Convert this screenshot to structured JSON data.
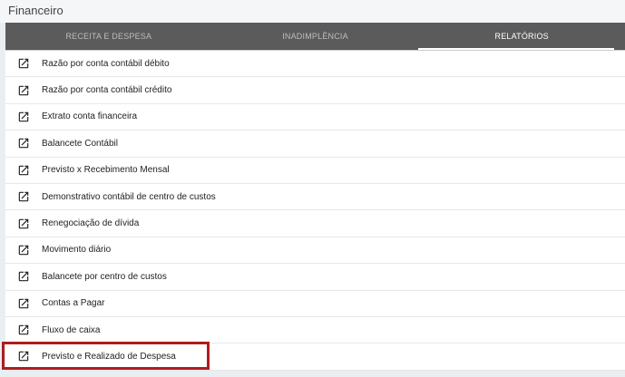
{
  "header": {
    "title": "Financeiro"
  },
  "tabs": [
    {
      "label": "RECEITA E DESPESA",
      "active": false
    },
    {
      "label": "INADIMPLÊNCIA",
      "active": false
    },
    {
      "label": "RELATÓRIOS",
      "active": true
    }
  ],
  "reports": [
    {
      "label": "Razão por conta contábil débito",
      "icon": "open-in-new-icon"
    },
    {
      "label": "Razão por conta contábil crédito",
      "icon": "open-in-new-icon"
    },
    {
      "label": "Extrato conta financeira",
      "icon": "open-in-new-icon"
    },
    {
      "label": "Balancete Contábil",
      "icon": "open-in-new-icon"
    },
    {
      "label": "Previsto x Recebimento Mensal",
      "icon": "open-in-new-icon"
    },
    {
      "label": "Demonstrativo contábil de centro de custos",
      "icon": "open-in-new-icon"
    },
    {
      "label": "Renegociação de dívida",
      "icon": "open-in-new-icon"
    },
    {
      "label": "Movimento diário",
      "icon": "open-in-new-icon"
    },
    {
      "label": "Balancete por centro de custos",
      "icon": "open-in-new-icon"
    },
    {
      "label": "Contas a Pagar",
      "icon": "open-in-new-icon"
    },
    {
      "label": "Fluxo de caixa",
      "icon": "open-in-new-icon"
    },
    {
      "label": "Previsto e Realizado de Despesa",
      "icon": "open-in-new-icon",
      "highlighted": true
    }
  ],
  "colors": {
    "tab_bar": "#5b5b5b",
    "highlight_border": "#b01c1c"
  }
}
